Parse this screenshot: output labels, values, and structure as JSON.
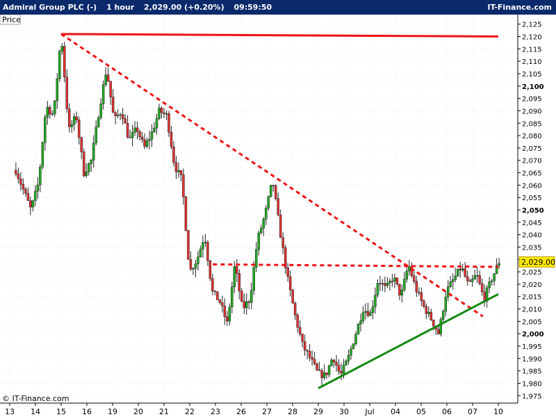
{
  "header": {
    "instrument": "Admiral Group PLC (-)",
    "timeframe": "1 hour",
    "price_change": "2,029.00 (+0.20%)",
    "time": "09:59:50",
    "site": "IT-Finance.com"
  },
  "chart_label": "Price",
  "watermark": "© IT-Finance.com",
  "current_price_label": "2,029.00",
  "colors": {
    "header_bg": "#0b2a6b",
    "up_candle": "#1faa1f",
    "down_candle": "#e03030",
    "resistance": "#ee1111",
    "support": "#118811",
    "price_tag": "#ffe800"
  },
  "chart_data": {
    "type": "candlestick",
    "ylim": [
      1972,
      2128
    ],
    "y_ticks": [
      1975,
      1980,
      1985,
      1990,
      1995,
      2000,
      2005,
      2010,
      2015,
      2020,
      2025,
      2030,
      2035,
      2040,
      2045,
      2050,
      2055,
      2060,
      2065,
      2070,
      2075,
      2080,
      2085,
      2090,
      2095,
      2100,
      2105,
      2110,
      2115,
      2120,
      2125
    ],
    "y_tick_labels": [
      "1,975",
      "1,980",
      "1,985",
      "1,990",
      "1,995",
      "2,000",
      "2,005",
      "2,010",
      "2,015",
      "2,020",
      "2,025",
      "2,030",
      "2,035",
      "2,040",
      "2,045",
      "2,050",
      "2,055",
      "2,060",
      "2,065",
      "2,070",
      "2,075",
      "2,080",
      "2,085",
      "2,090",
      "2,095",
      "2,100",
      "2,105",
      "2,110",
      "2,115",
      "2,120",
      "2,125"
    ],
    "y_major_ticks": [
      2000,
      2050,
      2100
    ],
    "x_labels": [
      "13",
      "14",
      "15",
      "16",
      "19",
      "20",
      "21",
      "22",
      "23",
      "26",
      "27",
      "28",
      "29",
      "30",
      "Jul",
      "04",
      "05",
      "06",
      "07",
      "10"
    ],
    "current_price": 2029,
    "path": [
      2066,
      2058,
      2050,
      2061,
      2092,
      2088,
      2121,
      2082,
      2088,
      2065,
      2070,
      2090,
      2107,
      2086,
      2090,
      2078,
      2083,
      2075,
      2081,
      2090,
      2088,
      2068,
      2062,
      2025,
      2030,
      2040,
      2017,
      2013,
      2004,
      2028,
      2010,
      2014,
      2038,
      2048,
      2062,
      2041,
      2022,
      2007,
      1995,
      1990,
      1984,
      1983,
      1991,
      1983,
      1990,
      2000,
      2010,
      2008,
      2022,
      2018,
      2023,
      2015,
      2028,
      2018,
      2011,
      2006,
      2000,
      2017,
      2022,
      2027,
      2019,
      2024,
      2014,
      2022,
      2029
    ],
    "trendlines": [
      {
        "type": "resistance",
        "style": "solid",
        "color": "#ee1111",
        "from": [
          2,
          2121
        ],
        "to": [
          19,
          2120
        ]
      },
      {
        "type": "resistance",
        "style": "dashed",
        "color": "#ee1111",
        "from": [
          2,
          2121
        ],
        "to": [
          18.4,
          2007
        ]
      },
      {
        "type": "resistance",
        "style": "dashed",
        "color": "#ee1111",
        "from": [
          7.9,
          2028
        ],
        "to": [
          19,
          2027
        ]
      },
      {
        "type": "support",
        "style": "solid",
        "color": "#118811",
        "from": [
          12,
          1978
        ],
        "to": [
          19,
          2016
        ]
      }
    ]
  }
}
